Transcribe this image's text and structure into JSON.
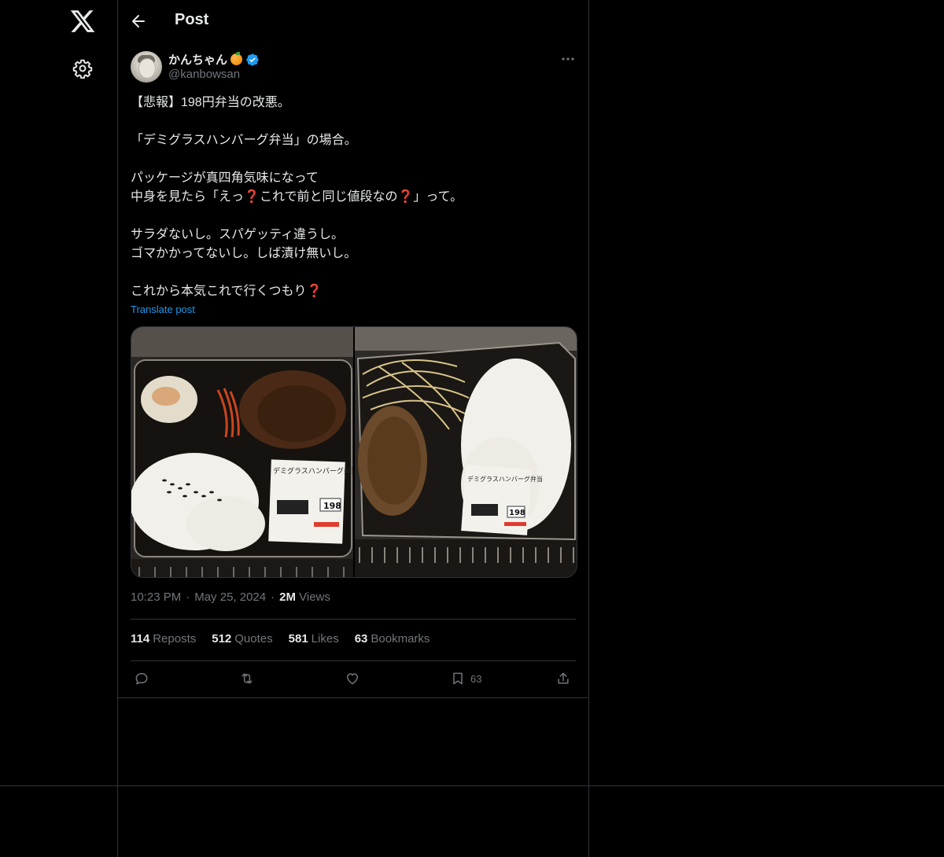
{
  "header": {
    "title": "Post"
  },
  "author": {
    "name": "かんちゃん",
    "handle": "@kanbowsan"
  },
  "post": {
    "lines": [
      "【悲報】198円弁当の改悪。",
      "",
      "「デミグラスハンバーグ弁当」の場合。",
      "",
      "パッケージが真四角気味になって",
      "中身を見たら「えっ❓これで前と同じ値段なの❓」って。",
      "",
      "サラダないし。スパゲッティ違うし。",
      "ゴマかかってないし。しば漬け無いし。",
      "",
      "これから本気これで行くつもり❓"
    ],
    "translate_label": "Translate post"
  },
  "media": {
    "image1": {
      "label_top": "デミグラスハンバーグ弁当",
      "price": "198"
    },
    "image2": {
      "label_top": "デミグラスハンバーグ弁当",
      "price": "198"
    }
  },
  "meta": {
    "time": "10:23 PM",
    "date": "May 25, 2024",
    "views_count": "2M",
    "views_label": "Views"
  },
  "stats": [
    {
      "num": "114",
      "label": "Reposts"
    },
    {
      "num": "512",
      "label": "Quotes"
    },
    {
      "num": "581",
      "label": "Likes"
    },
    {
      "num": "63",
      "label": "Bookmarks"
    }
  ],
  "actions": {
    "bookmark_count": "63"
  },
  "icons": {
    "nav": [
      "x-logo-icon",
      "gear-icon"
    ],
    "header": [
      "back-arrow-icon"
    ],
    "actions": [
      "reply-icon",
      "repost-icon",
      "like-icon",
      "bookmark-icon",
      "share-icon"
    ]
  },
  "colors": {
    "background": "#000000",
    "text": "#e7e9ea",
    "muted": "#71767b",
    "accent": "#1d9bf0",
    "border": "#2f3336",
    "question_mark": "#e0245e"
  }
}
